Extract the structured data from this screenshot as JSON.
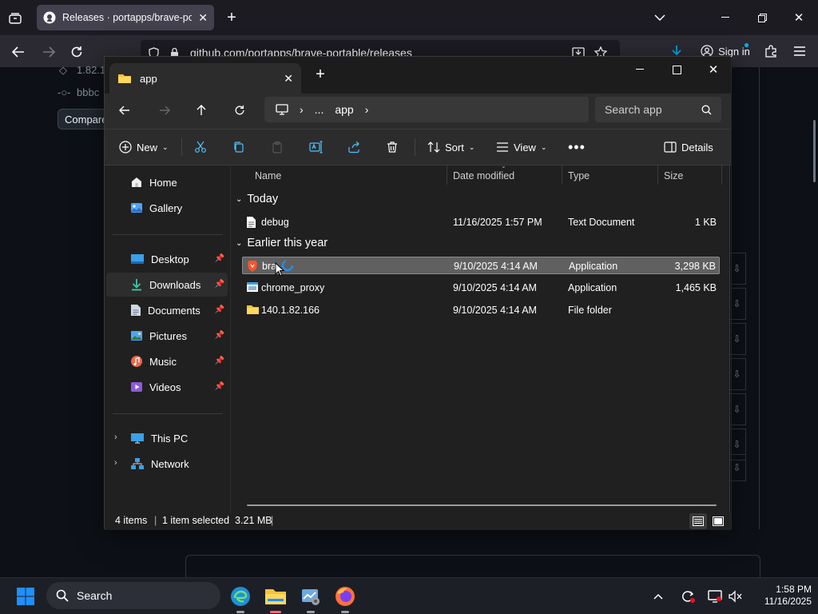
{
  "browser": {
    "tab_title": "Releases · portapps/brave-portable",
    "url": "github.com/portapps/brave-portable/releases",
    "sign_in": "Sign in"
  },
  "github": {
    "version_snippet": "1.82.1",
    "commit_snippet": "bbbc",
    "compare_label": "Compare"
  },
  "explorer": {
    "tab_label": "app",
    "breadcrumb": [
      "...",
      "app"
    ],
    "search_placeholder": "Search app",
    "toolbar": {
      "new": "New",
      "sort": "Sort",
      "view": "View",
      "details": "Details"
    },
    "sidebar": {
      "top": [
        {
          "label": "Home",
          "icon": "home-icon"
        },
        {
          "label": "Gallery",
          "icon": "gallery-icon"
        }
      ],
      "pinned": [
        {
          "label": "Desktop",
          "icon": "desktop-icon"
        },
        {
          "label": "Downloads",
          "icon": "downloads-icon",
          "selected": true
        },
        {
          "label": "Documents",
          "icon": "documents-icon"
        },
        {
          "label": "Pictures",
          "icon": "pictures-icon"
        },
        {
          "label": "Music",
          "icon": "music-icon"
        },
        {
          "label": "Videos",
          "icon": "videos-icon"
        }
      ],
      "bottom": [
        {
          "label": "This PC",
          "icon": "pc-icon"
        },
        {
          "label": "Network",
          "icon": "network-icon"
        }
      ]
    },
    "columns": [
      "Name",
      "Date modified",
      "Type",
      "Size"
    ],
    "groups": [
      {
        "label": "Today",
        "files": [
          {
            "name": "debug",
            "date": "11/16/2025 1:57 PM",
            "type": "Text Document",
            "size": "1 KB",
            "icon": "text-file-icon"
          }
        ]
      },
      {
        "label": "Earlier this year",
        "files": [
          {
            "name": "bra",
            "date": "9/10/2025 4:14 AM",
            "type": "Application",
            "size": "3,298 KB",
            "icon": "brave-app-icon",
            "selected": true
          },
          {
            "name": "chrome_proxy",
            "date": "9/10/2025 4:14 AM",
            "type": "Application",
            "size": "1,465 KB",
            "icon": "app-window-icon"
          },
          {
            "name": "140.1.82.166",
            "date": "9/10/2025 4:14 AM",
            "type": "File folder",
            "size": "",
            "icon": "folder-icon"
          }
        ]
      }
    ],
    "status": {
      "items": "4 items",
      "selection": "1 item selected  3.21 MB"
    }
  },
  "taskbar": {
    "search_label": "Search",
    "time": "1:58 PM",
    "date": "11/16/2025"
  },
  "colors": {
    "explorer_bg": "#202020",
    "selected_row": "#606060",
    "folder_yellow": "#f5c33b",
    "windows_blue": "#1e90ff"
  }
}
